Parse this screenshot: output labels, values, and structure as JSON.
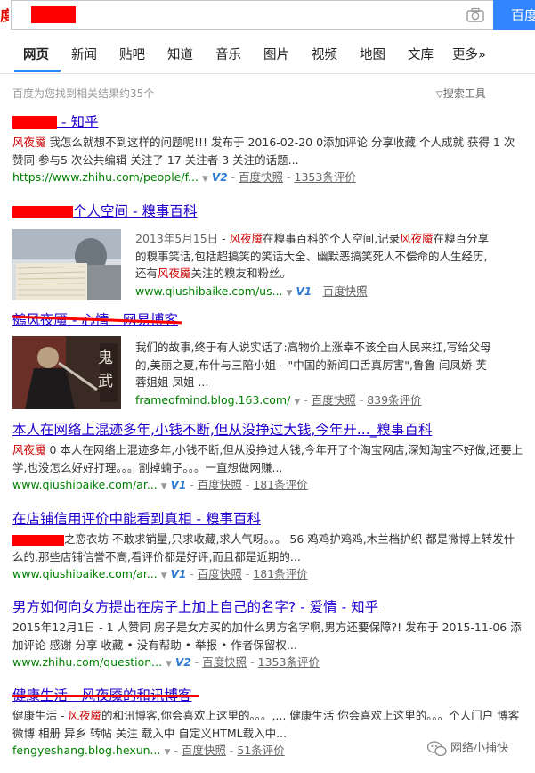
{
  "header": {
    "logo_fragment": "度",
    "search_button": "百度一下",
    "camera_icon": "camera-icon"
  },
  "tabs": [
    {
      "label": "网页",
      "active": true
    },
    {
      "label": "新闻"
    },
    {
      "label": "贴吧"
    },
    {
      "label": "知道"
    },
    {
      "label": "音乐"
    },
    {
      "label": "图片"
    },
    {
      "label": "视频"
    },
    {
      "label": "地图"
    },
    {
      "label": "文库"
    },
    {
      "label": "更多»"
    }
  ],
  "stats": "百度为您找到相关结果约35个",
  "tools_label": "搜索工具",
  "results": [
    {
      "title_site": " - 知乎",
      "abstract_hl": "风夜魇",
      "abstract": " 我怎么就想不到这样的问题呢!!! 发布于 2016-02-20 0添加评论 分享收藏 个人成就 获得 1 次赞同 参与5 次公共编辑 关注了 17 关注者 3 关注的话题...",
      "url": "https://www.zhihu.com/people/f...",
      "badge": "V2",
      "cache": "百度快照",
      "reviews": "1353条评价"
    },
    {
      "title_mid": "个人空间",
      "title_site": " - 糗事百科",
      "date": "2013年5月15日",
      "abstract_pre": " - ",
      "abstract_hl": "风夜魇",
      "abstract_a": "在糗事百科的个人空间,记录",
      "abstract_hl2": "风夜魇",
      "abstract_b": "在糗百分享的糗事笑话,包括超搞笑的笑话大全、幽默恶搞笑死人不偿命的人生经历,还有",
      "abstract_hl3": "风夜魇",
      "abstract_c": "关注的糗友和粉丝。",
      "url": "www.qiushibaike.com/us...",
      "badge": "V1",
      "cache": "百度快照"
    },
    {
      "title": "鵺风夜魇 - 心情 - 网易博客",
      "abstract": "我们的故事,终于有人说实话了:高物价上涨幸不该全由人民来扛,写给父母的,美丽之夏,布什与三陪小姐---\"中国的新闻口舌真厉害\",鲁鲁 闫凤娇 芙蓉姐姐 凤姐 ...",
      "url": "frameofmind.blog.163.com/",
      "cache": "百度快照",
      "reviews": "839条评价",
      "thumb_text": "鬼武"
    },
    {
      "title": "本人在网络上混迹多年,小钱不断,但从没挣过大钱,今年开..._糗事百科",
      "abstract_hl": "风夜魇",
      "abstract": " 0 本人在网络上混迹多年,小钱不断,但从没挣过大钱,今年开了个淘宝网店,深知淘宝不好做,还要上学,也没怎么好好打理。。。割掉蝻子。。。一直想做网赚...",
      "url": "www.qiushibaike.com/ar...",
      "badge": "V1",
      "cache": "百度快照",
      "reviews": "181条评价"
    },
    {
      "title": "在店铺信用评价中能看到真相 - 糗事百科",
      "abstract": "之恋衣坊 不敢求销量,只求收藏,求人气呀。。。 56 鸡鸡护鸡鸡,木兰档护织 都是微博上转发什么的,那些店铺信誉不高,看评价都是好评,而且都是近期的...",
      "url": "www.qiushibaike.com/ar...",
      "badge": "V1",
      "cache": "百度快照",
      "reviews": "181条评价"
    },
    {
      "title": "男方如何向女方提出在房子上加上自己的名字? - 爱情 - 知乎",
      "abstract": "2015年12月1日 - 1 人赞同 房子是女方买的加什么男方名字啊,男方还要保障?! 发布于 2015-11-06 添加评论 感谢 分享 收藏 • 没有帮助 • 举报 • 作者保留权...",
      "url": "www.zhihu.com/question...",
      "badge": "V2",
      "cache": "百度快照",
      "reviews": "1353条评价"
    },
    {
      "title": "健康生活 - 风夜魇的和讯博客",
      "abstract_a": "健康生活 - ",
      "abstract_hl": "风夜魇",
      "abstract_b": "的和讯博客,你会喜欢上这里的。。。,... 健康生活 你会喜欢上这里的。。。个人门户 博客 微博 相册 异乡 转帖 关注 载入中 自定义HTML载入中...",
      "url": "fengyeshang.blog.hexun...",
      "cache": "百度快照",
      "reviews": "51条评价"
    }
  ],
  "watermark": "网络小捕快",
  "colors": {
    "link": "#2200cc",
    "url": "#008000",
    "highlight": "#cc0000",
    "accent": "#3385ff",
    "redaction": "#ff0000"
  }
}
